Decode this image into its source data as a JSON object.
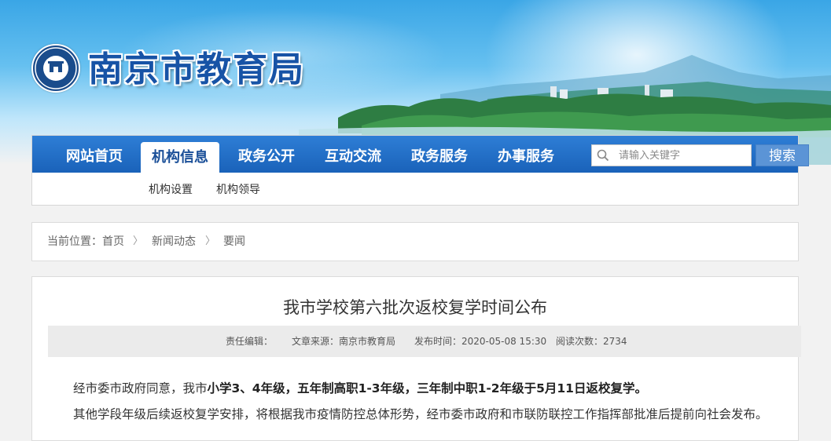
{
  "site": {
    "title": "南京市教育局"
  },
  "nav": {
    "items": [
      "网站首页",
      "机构信息",
      "政务公开",
      "互动交流",
      "政务服务",
      "办事服务"
    ],
    "active_index": 1,
    "sub_items": [
      "机构设置",
      "机构领导"
    ],
    "search_placeholder": "请输入关键字",
    "search_button": "搜索"
  },
  "breadcrumb": {
    "prefix": "当前位置：",
    "items": [
      "首页",
      "新闻动态",
      "要闻"
    ],
    "separator": "〉"
  },
  "article": {
    "title": "我市学校第六批次返校复学时间公布",
    "meta": {
      "editor": "责任编辑：",
      "source": "文章来源：南京市教育局",
      "publish_time": "发布时间：2020-05-08 15:30",
      "views": "阅读次数：2734"
    },
    "para1_prefix": "经市委市政府同意，我市",
    "para1_bold": "小学3、4年级，五年制高职1-3年级，三年制中职1-2年级于5月11日返校复学。",
    "para2": "其他学段年级后续返校复学安排，将根据我市疫情防控总体形势，经市委市政府和市联防联控工作指挥部批准后提前向社会发布。"
  },
  "colors": {
    "nav_blue": "#1a62b9",
    "title_blue": "#1753a6"
  },
  "icons": [
    "school-logo-icon",
    "search-icon"
  ]
}
